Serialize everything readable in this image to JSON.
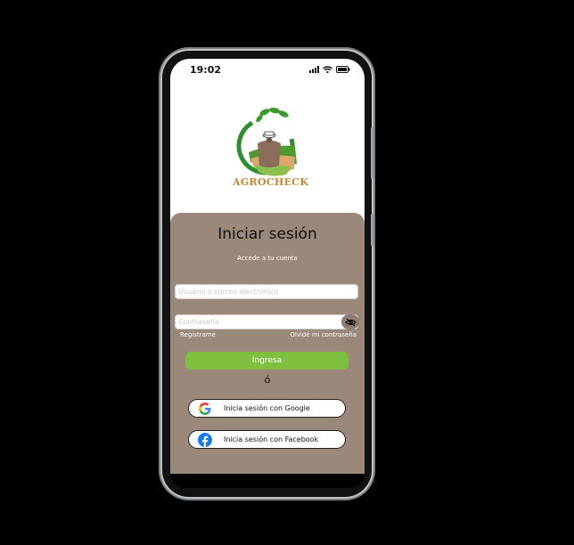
{
  "status": {
    "time": "19:02",
    "icons": [
      "signal-icon",
      "wifi-icon",
      "battery-icon"
    ]
  },
  "logo": {
    "text": "AGROCHECK"
  },
  "login": {
    "title": "Iniciar sesión",
    "subtitle": "Accede a tu cuenta",
    "username_placeholder": "Usuario o correo electrónico",
    "password_placeholder": "Contraseña",
    "register_link": "Registrame",
    "forgot_link": "Olvidé mi contraseña",
    "submit_label": "Ingresa",
    "or_text": "ó",
    "google_label": "Inicia sesión con Google",
    "facebook_label": "Inicia sesión con Facebook"
  },
  "colors": {
    "card_bg": "#9a887b",
    "primary_button": "#7fbf3f",
    "logo_text": "#c8872f"
  }
}
